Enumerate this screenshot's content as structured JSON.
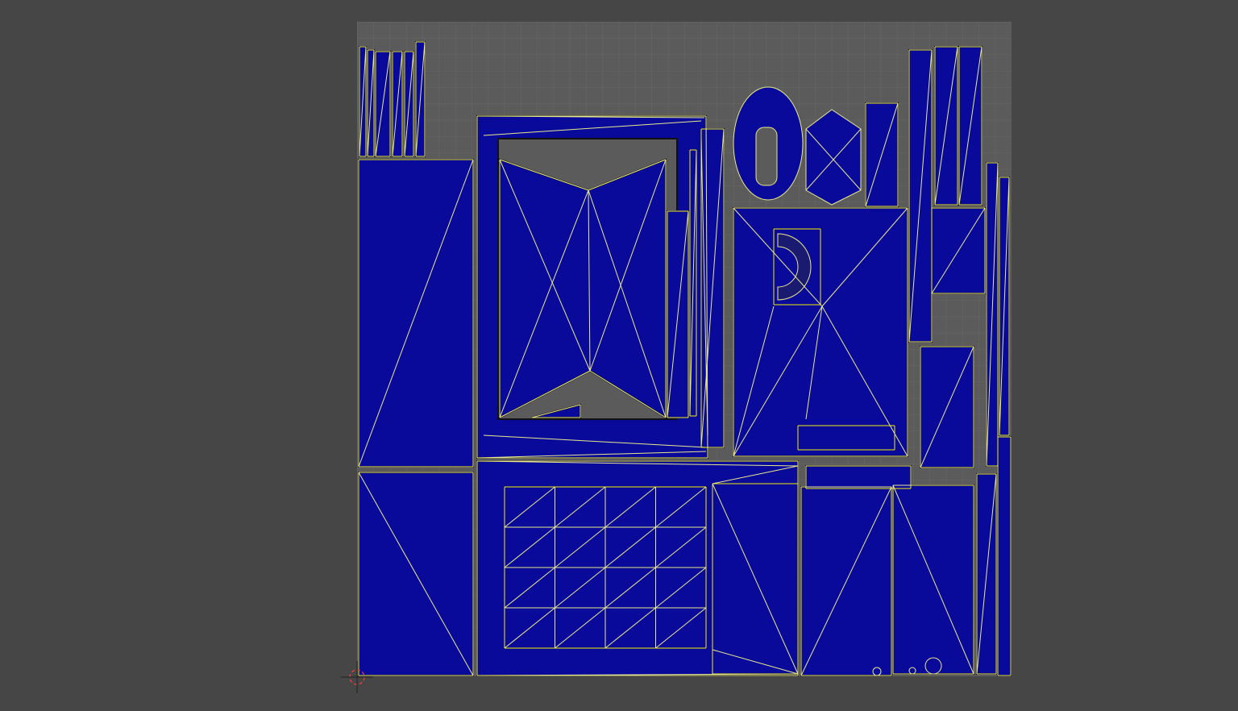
{
  "editor": {
    "background_color": "#464646",
    "grid_background_color": "#5b5b5b",
    "grid_line_color": "#676767",
    "island_fill_color": "#0a0a9a",
    "wire_edge_color": "#e8e890",
    "island_outline_color": "#111111",
    "cursor_color": "#d84040"
  },
  "uv_islands": {
    "count": 30,
    "icon": "uv-island-mesh"
  },
  "cursor": {
    "icon": "2d-cursor-crosshair-icon"
  }
}
